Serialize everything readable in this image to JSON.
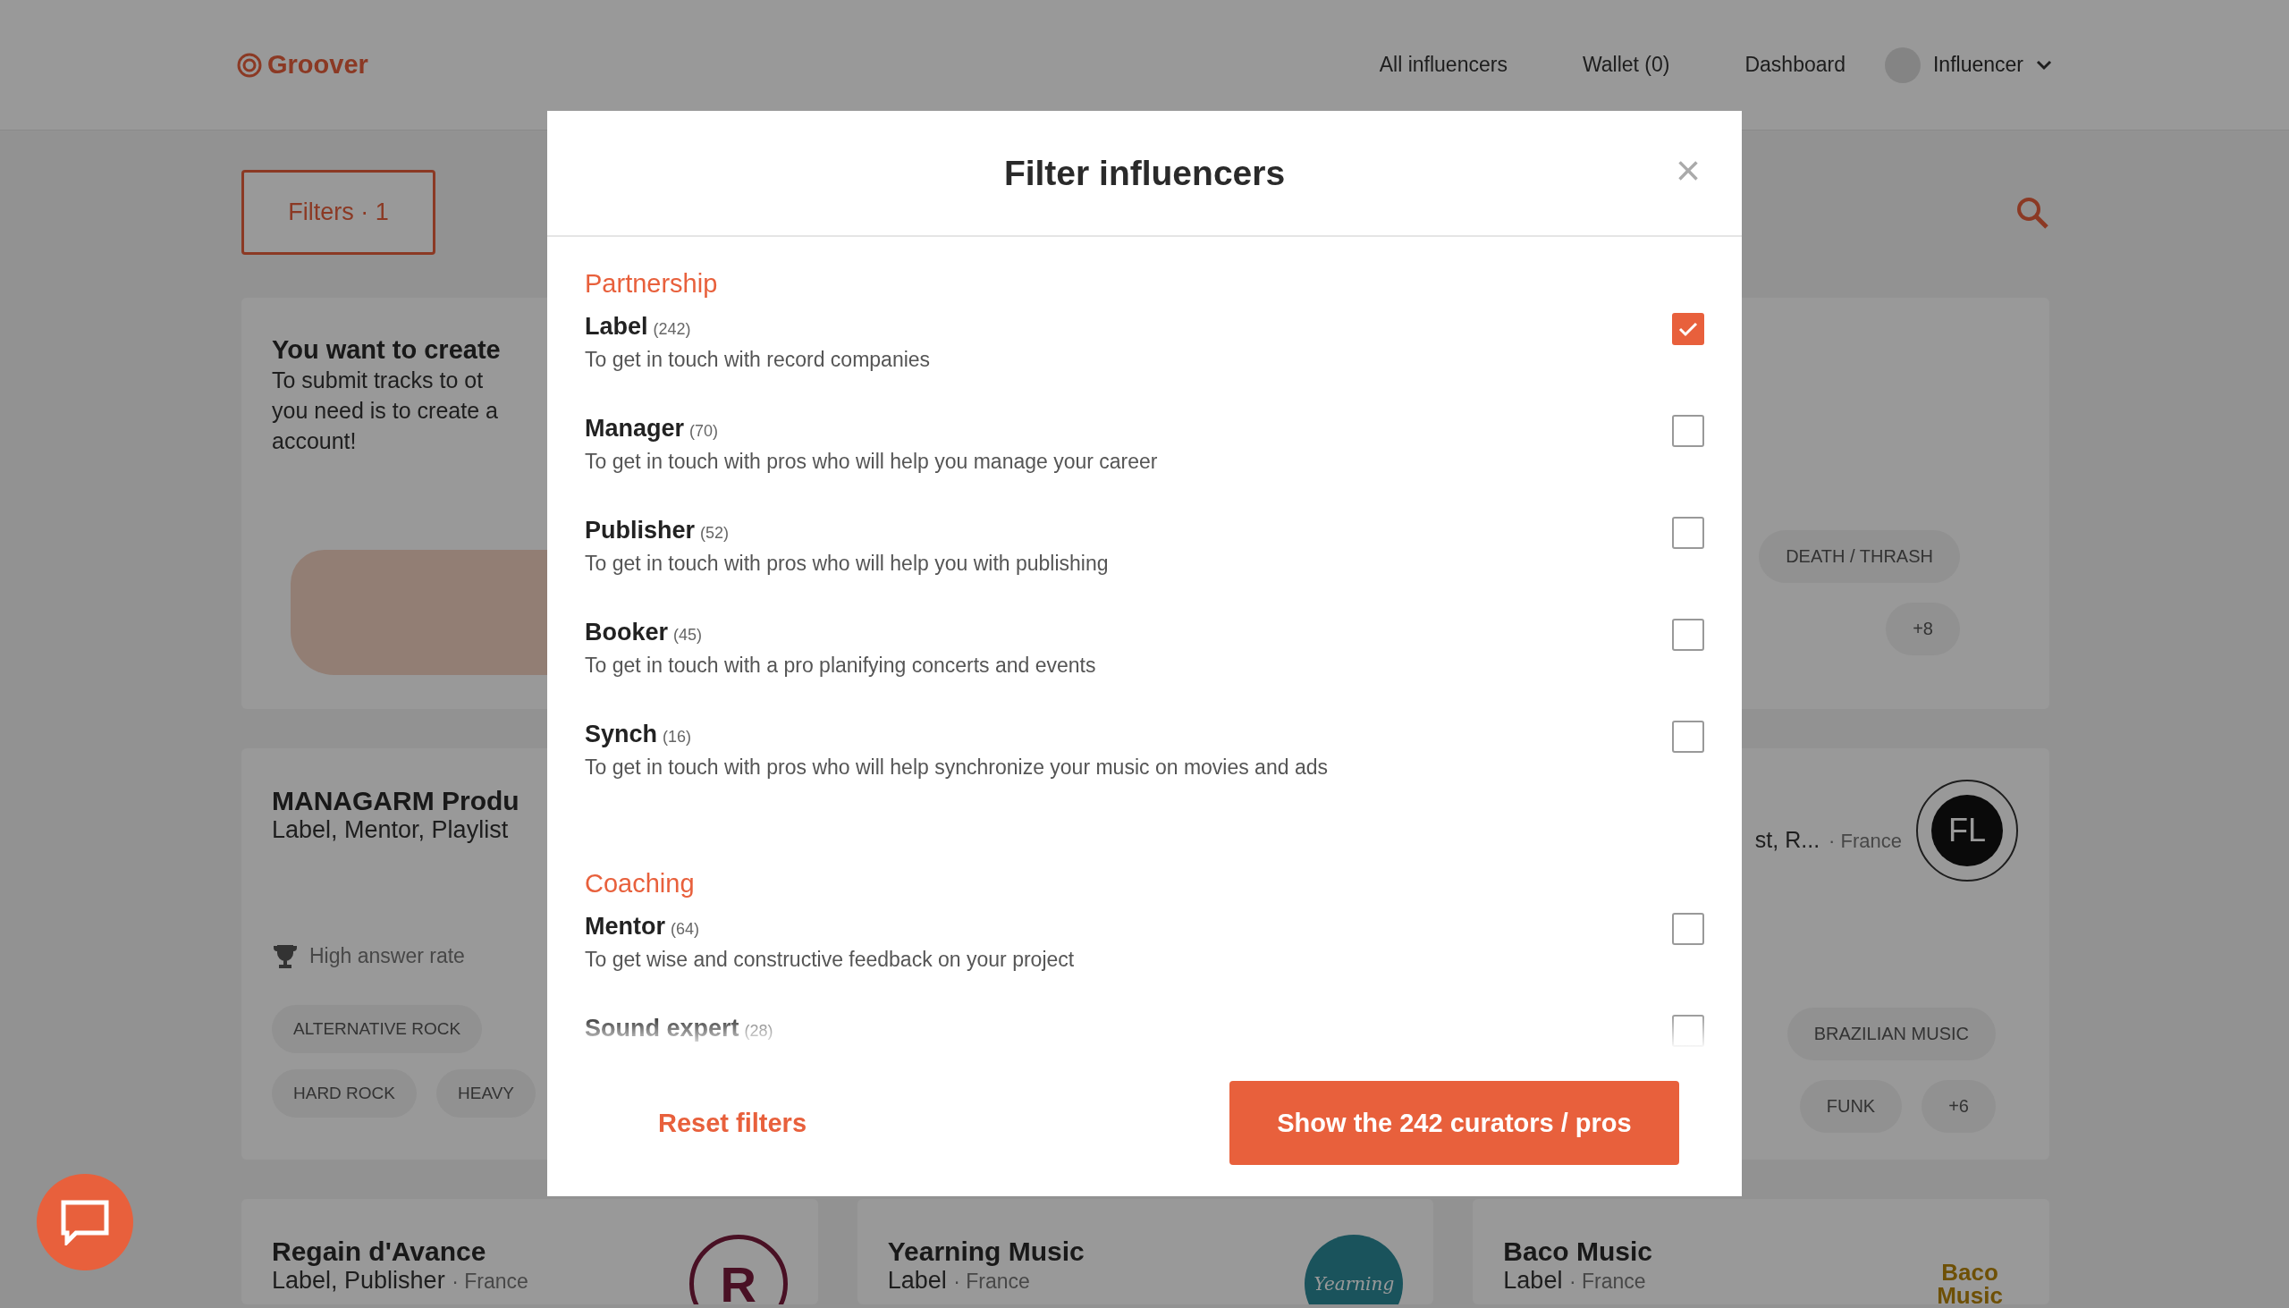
{
  "header": {
    "logo": "Groover",
    "nav": [
      "All influencers",
      "Wallet (0)",
      "Dashboard"
    ],
    "account": "Influencer"
  },
  "toolbar": {
    "filters_button": "Filters · 1"
  },
  "cards": [
    {
      "kind": "promo",
      "title": "You want to create",
      "lines": [
        "To submit tracks to ot",
        "you need is to create a",
        "account!"
      ]
    },
    {
      "kind": "tagsonly",
      "tags": [
        "DEATH / THRASH",
        "+8"
      ]
    },
    {
      "kind": "curator",
      "name": "MANAGARM Produ",
      "roles": "Label, Mentor, Playlist",
      "badge": "High answer rate",
      "tag_rows": [
        [
          "ALTERNATIVE ROCK"
        ],
        [
          "HARD ROCK",
          "HEAVY"
        ]
      ]
    },
    {
      "kind": "partial",
      "roles": "st, R...",
      "country": "· France",
      "logo_text": "FL",
      "tags": [
        "BRAZILIAN MUSIC",
        "FUNK",
        "+6"
      ]
    },
    {
      "kind": "small",
      "name": "Regain d'Avance",
      "roles": "Label, Publisher",
      "country": "· France",
      "logo": {
        "kind": "ring",
        "text": "R"
      }
    },
    {
      "kind": "small",
      "name": "Yearning Music",
      "roles": "Label",
      "country": "· France",
      "logo": {
        "kind": "teal",
        "text": "Yearning"
      }
    },
    {
      "kind": "small",
      "name": "Baco Music",
      "roles": "Label",
      "country": "· France",
      "logo": {
        "kind": "plain",
        "text": "Baco Music"
      }
    }
  ],
  "modal": {
    "title": "Filter influencers",
    "close": "×",
    "sections": [
      {
        "title": "Partnership",
        "items": [
          {
            "name": "Label",
            "count": "(242)",
            "description": "To get in touch with record companies",
            "checked": true
          },
          {
            "name": "Manager",
            "count": "(70)",
            "description": "To get in touch with pros who will help you manage your career",
            "checked": false
          },
          {
            "name": "Publisher",
            "count": "(52)",
            "description": "To get in touch with pros who will help you with publishing",
            "checked": false
          },
          {
            "name": "Booker",
            "count": "(45)",
            "description": "To get in touch with a pro planifying concerts and events",
            "checked": false
          },
          {
            "name": "Synch",
            "count": "(16)",
            "description": "To get in touch with pros who will help synchronize your music on movies and ads",
            "checked": false
          }
        ]
      },
      {
        "title": "Coaching",
        "items": [
          {
            "name": "Mentor",
            "count": "(64)",
            "description": "To get wise and constructive feedback on your project",
            "checked": false
          },
          {
            "name": "Sound expert",
            "count": "(28)",
            "checked": false
          }
        ]
      }
    ],
    "reset": "Reset filters",
    "submit": "Show the 242 curators / pros"
  }
}
